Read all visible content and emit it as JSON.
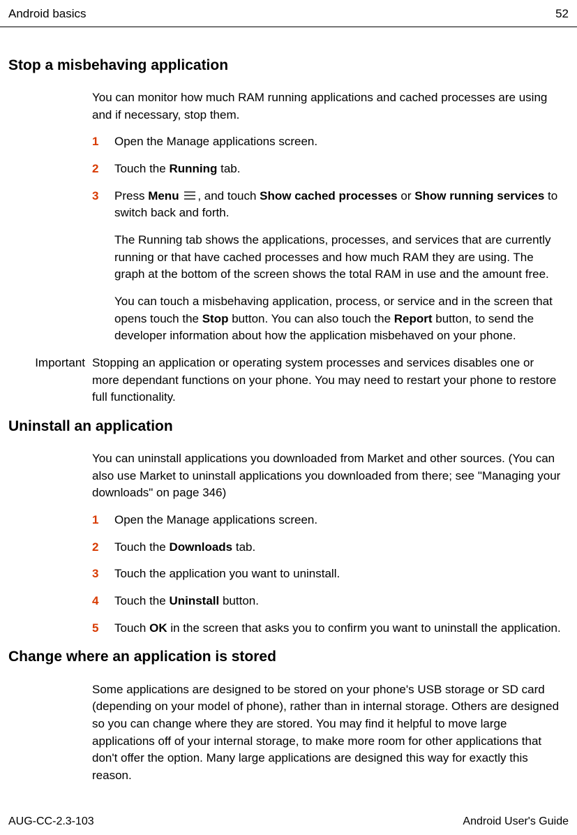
{
  "header": {
    "left": "Android basics",
    "right": "52"
  },
  "footer": {
    "left": "AUG-CC-2.3-103",
    "right": "Android User's Guide"
  },
  "sec1": {
    "title": "Stop a misbehaving application",
    "intro": "You can monitor how much RAM running applications and cached processes are using and if necessary, stop them.",
    "step1_num": "1",
    "step1": "Open the Manage applications screen.",
    "step2_num": "2",
    "step2_a": "Touch the ",
    "step2_b": "Running",
    "step2_c": " tab.",
    "step3_num": "3",
    "step3_a": "Press ",
    "step3_b": "Menu",
    "step3_c": ", and touch ",
    "step3_d": "Show cached processes",
    "step3_e": " or ",
    "step3_f": "Show running services",
    "step3_g": " to switch back and forth.",
    "step3_sub1": "The Running tab shows the applications, processes, and services that are currently running or that have cached processes and how much RAM they are using. The graph at the bottom of the screen shows the total RAM in use and the amount free.",
    "step3_sub2_a": "You can touch a misbehaving application, process, or service and in the screen that opens touch the ",
    "step3_sub2_b": "Stop",
    "step3_sub2_c": " button. You can also touch the ",
    "step3_sub2_d": "Report",
    "step3_sub2_e": " button, to send the developer information about how the application misbehaved on your phone.",
    "important_label": "Important",
    "important_text": "Stopping an application or operating system processes and services disables one or more dependant functions on your phone. You may need to restart your phone to restore full functionality."
  },
  "sec2": {
    "title": "Uninstall an application",
    "intro": "You can uninstall applications you downloaded from Market and other sources. (You can also use Market to uninstall applications you downloaded from there; see \"Managing your downloads\" on page 346)",
    "step1_num": "1",
    "step1": "Open the Manage applications screen.",
    "step2_num": "2",
    "step2_a": "Touch the ",
    "step2_b": "Downloads",
    "step2_c": " tab.",
    "step3_num": "3",
    "step3": "Touch the application you want to uninstall.",
    "step4_num": "4",
    "step4_a": "Touch the ",
    "step4_b": "Uninstall",
    "step4_c": " button.",
    "step5_num": "5",
    "step5_a": "Touch ",
    "step5_b": "OK",
    "step5_c": " in the screen that asks you to confirm you want to uninstall the application."
  },
  "sec3": {
    "title": "Change where an application is stored",
    "intro": "Some applications are designed to be stored on your phone's USB storage or SD card (depending on your model of phone), rather than in internal storage. Others are designed so you can change where they are stored. You may find it helpful to move large applications off of your internal storage, to make more room for other applications that don't offer the option. Many large applications are designed this way for exactly this reason."
  }
}
